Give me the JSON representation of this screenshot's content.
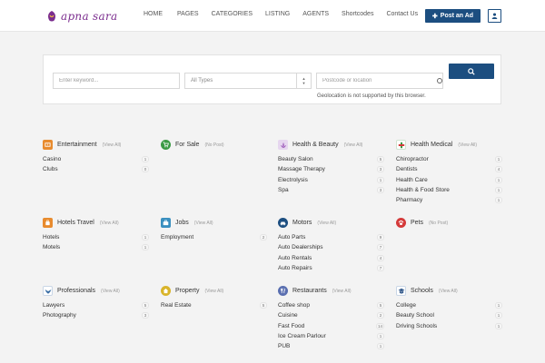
{
  "header": {
    "logo_text": "apna sara",
    "nav": [
      "HOME",
      "PAGES",
      "CATEGORIES",
      "LISTING",
      "AGENTS",
      "Shortcodes",
      "Contact Us"
    ],
    "post_ad_label": "Post an Ad"
  },
  "search": {
    "keyword_placeholder": "Enter keyword...",
    "type_selected": "All Types",
    "location_placeholder": "Postcode or location",
    "geo_message": "Geolocation is not supported by this browser."
  },
  "categories": [
    {
      "name": "Entertainment",
      "link": "(View All)",
      "color": "#e88b2e",
      "icon": "ticket-icon",
      "items": [
        {
          "name": "Casino",
          "count": "1"
        },
        {
          "name": "Clubs",
          "count": "0"
        }
      ]
    },
    {
      "name": "For Sale",
      "link": "(No Post)",
      "color": "#3b9a44",
      "icon": "cart-icon",
      "items": []
    },
    {
      "name": "Health & Beauty",
      "link": "(View All)",
      "color": "#9a56b8",
      "icon": "lotus-icon",
      "items": [
        {
          "name": "Beauty Salon",
          "count": "5"
        },
        {
          "name": "Massage Therapy",
          "count": "3"
        },
        {
          "name": "Electrolysis",
          "count": "1"
        },
        {
          "name": "Spa",
          "count": "3"
        }
      ]
    },
    {
      "name": "Health Medical",
      "link": "(View All)",
      "color": "#3b9a44",
      "icon": "medical-cross-icon",
      "items": [
        {
          "name": "Chiropractor",
          "count": "1"
        },
        {
          "name": "Dentists",
          "count": "4"
        },
        {
          "name": "Health Care",
          "count": "1"
        },
        {
          "name": "Health & Food Store",
          "count": "1"
        },
        {
          "name": "Pharmacy",
          "count": "1"
        }
      ]
    },
    {
      "name": "Hotels Travel",
      "link": "(View All)",
      "color": "#e88b2e",
      "icon": "luggage-icon",
      "items": [
        {
          "name": "Hotels",
          "count": "1"
        },
        {
          "name": "Motels",
          "count": "1"
        }
      ]
    },
    {
      "name": "Jobs",
      "link": "(View All)",
      "color": "#3a8fbf",
      "icon": "briefcase-icon",
      "items": [
        {
          "name": "Employment",
          "count": "2"
        }
      ]
    },
    {
      "name": "Motors",
      "link": "(View All)",
      "color": "#1c4e80",
      "icon": "car-icon",
      "items": [
        {
          "name": "Auto Parts",
          "count": "9"
        },
        {
          "name": "Auto Dealerships",
          "count": "7"
        },
        {
          "name": "Auto Rentals",
          "count": "4"
        },
        {
          "name": "Auto Repairs",
          "count": "7"
        }
      ]
    },
    {
      "name": "Pets",
      "link": "(No Post)",
      "color": "#d43a3a",
      "icon": "paw-icon",
      "items": []
    },
    {
      "name": "Professionals",
      "link": "(View All)",
      "color": "#3a6ea5",
      "icon": "eagle-icon",
      "items": [
        {
          "name": "Lawyers",
          "count": "5"
        },
        {
          "name": "Photography",
          "count": "3"
        }
      ]
    },
    {
      "name": "Property",
      "link": "(View All)",
      "color": "#d9b42a",
      "icon": "house-icon",
      "items": [
        {
          "name": "Real Estate",
          "count": "5"
        }
      ]
    },
    {
      "name": "Restaurants",
      "link": "(View All)",
      "color": "#5a6fb0",
      "icon": "fork-knife-icon",
      "items": [
        {
          "name": "Coffee shop",
          "count": "5"
        },
        {
          "name": "Cuisine",
          "count": "2"
        },
        {
          "name": "Fast Food",
          "count": "14"
        },
        {
          "name": "Ice Cream Parlour",
          "count": "1"
        },
        {
          "name": "PUB",
          "count": "1"
        }
      ]
    },
    {
      "name": "Schools",
      "link": "(View All)",
      "color": "#3a5f8f",
      "icon": "school-icon",
      "items": [
        {
          "name": "College",
          "count": "1"
        },
        {
          "name": "Beauty School",
          "count": "1"
        },
        {
          "name": "Driving Schools",
          "count": "1"
        }
      ]
    }
  ]
}
